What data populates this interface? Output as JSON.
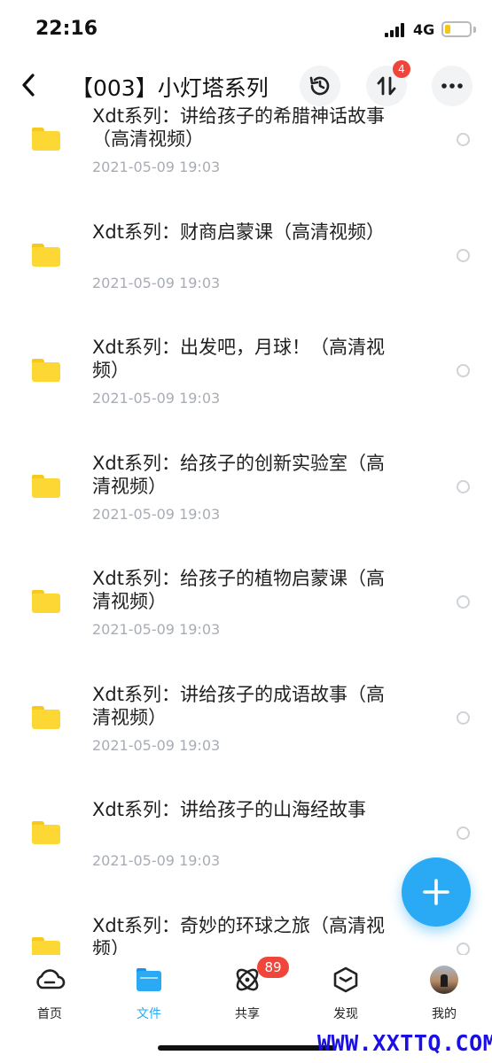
{
  "status_bar": {
    "time": "22:16",
    "network": "4G",
    "battery_level": 0.22,
    "battery_color": "#f5c518"
  },
  "header": {
    "back_icon": "chevron-left-icon",
    "title": "【003】小灯塔系列",
    "history_icon": "history-icon",
    "transfer_icon": "transfer-icon",
    "transfer_badge": "4",
    "more_icon": "more-icon"
  },
  "files": [
    {
      "title": "Xdt系列：讲给孩子的希腊神话故事（高清视频）",
      "date": "2021-05-09 19:03"
    },
    {
      "title": "Xdt系列：财商启蒙课（高清视频）",
      "date": "2021-05-09 19:03"
    },
    {
      "title": "Xdt系列：出发吧，月球！（高清视频）",
      "date": "2021-05-09 19:03"
    },
    {
      "title": "Xdt系列：给孩子的创新实验室（高清视频）",
      "date": "2021-05-09 19:03"
    },
    {
      "title": "Xdt系列：给孩子的植物启蒙课（高清视频）",
      "date": "2021-05-09 19:03"
    },
    {
      "title": "Xdt系列：讲给孩子的成语故事（高清视频）",
      "date": "2021-05-09 19:03"
    },
    {
      "title": "Xdt系列：讲给孩子的山海经故事",
      "date": "2021-05-09 19:03"
    },
    {
      "title": "Xdt系列：奇妙的环球之旅（高清视频）",
      "date": ""
    }
  ],
  "fab": {
    "icon": "plus-icon"
  },
  "tab_bar": {
    "tabs": [
      {
        "label": "首页",
        "icon": "cloud-icon"
      },
      {
        "label": "文件",
        "icon": "folder-icon"
      },
      {
        "label": "共享",
        "icon": "share-orbit-icon"
      },
      {
        "label": "发现",
        "icon": "cube-icon"
      },
      {
        "label": "我的",
        "icon": "avatar"
      }
    ],
    "share_badge": "89"
  },
  "colors": {
    "accent": "#2aa9f5",
    "badge": "#f0453a",
    "folder": "#fdd835",
    "date": "#a8adb5"
  },
  "watermark": "WWW.XXTTQ.COM"
}
